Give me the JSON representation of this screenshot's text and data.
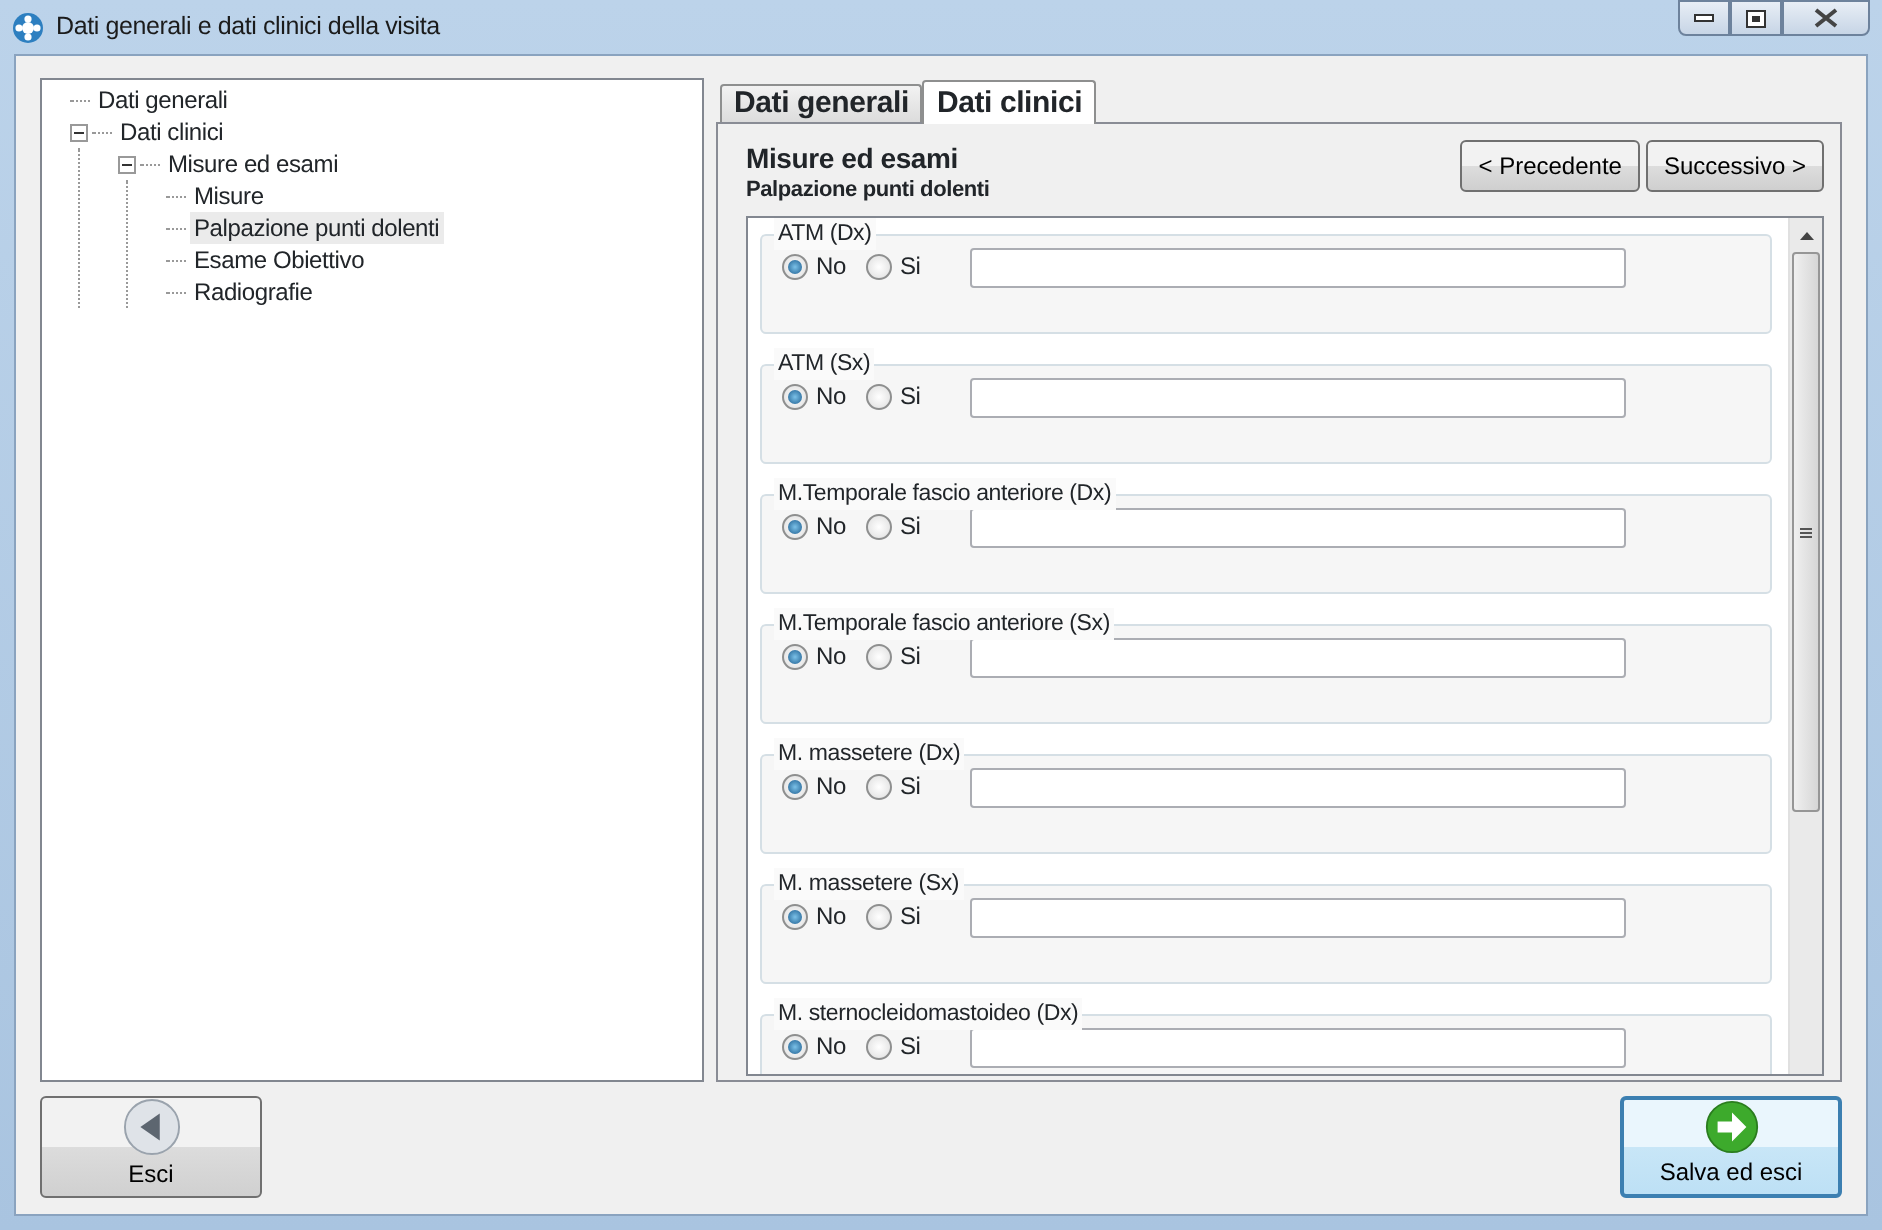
{
  "window": {
    "title": "Dati generali e dati clinici della visita"
  },
  "tree": [
    {
      "label": "Dati generali",
      "selected": false
    },
    {
      "label": "Dati clinici",
      "selected": false,
      "expanded": true,
      "children": [
        {
          "label": "Misure ed esami",
          "selected": false,
          "expanded": true,
          "children": [
            {
              "label": "Misure",
              "selected": false
            },
            {
              "label": "Palpazione punti dolenti",
              "selected": true
            },
            {
              "label": "Esame Obiettivo",
              "selected": false
            },
            {
              "label": "Radiografie",
              "selected": false
            }
          ]
        }
      ]
    }
  ],
  "tabs": [
    {
      "label": "Dati generali",
      "selected": false
    },
    {
      "label": "Dati clinici",
      "selected": true
    }
  ],
  "section": {
    "title": "Misure ed esami",
    "subtitle": "Palpazione punti dolenti"
  },
  "nav_buttons": [
    "< Precedente",
    "Successivo >"
  ],
  "groups": [
    {
      "label": "ATM (Dx)",
      "options": [
        {
          "label": "No",
          "selected": true
        },
        {
          "label": "Si",
          "selected": false
        }
      ]
    },
    {
      "label": "ATM (Sx)",
      "options": [
        {
          "label": "No",
          "selected": true
        },
        {
          "label": "Si",
          "selected": false
        }
      ]
    },
    {
      "label": "M.Temporale fascio anteriore (Dx)",
      "options": [
        {
          "label": "No",
          "selected": true
        },
        {
          "label": "Si",
          "selected": false
        }
      ]
    },
    {
      "label": "M.Temporale fascio anteriore (Sx)",
      "options": [
        {
          "label": "No",
          "selected": true
        },
        {
          "label": "Si",
          "selected": false
        }
      ]
    },
    {
      "label": "M. massetere (Dx)",
      "options": [
        {
          "label": "No",
          "selected": true
        },
        {
          "label": "Si",
          "selected": false
        }
      ]
    },
    {
      "label": "M. massetere (Sx)",
      "options": [
        {
          "label": "No",
          "selected": true
        },
        {
          "label": "Si",
          "selected": false
        }
      ]
    },
    {
      "label": "M. sternocleidomastoideo (Dx)",
      "options": [
        {
          "label": "No",
          "selected": true
        },
        {
          "label": "Si",
          "selected": false
        }
      ]
    }
  ],
  "footer": {
    "back": "Esci",
    "save": "Salva ed esci"
  }
}
